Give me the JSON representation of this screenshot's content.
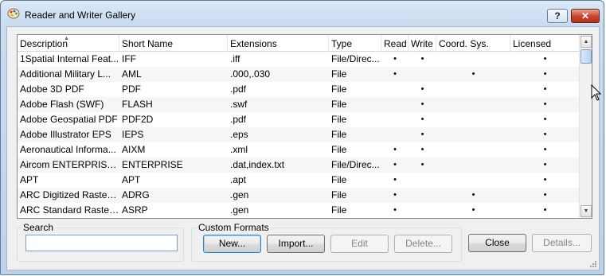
{
  "window": {
    "title": "Reader and Writer Gallery",
    "help_label": "?",
    "close_label": "✕"
  },
  "table": {
    "sorted_by": "Description",
    "headers": {
      "description": "Description",
      "short_name": "Short Name",
      "extensions": "Extensions",
      "type": "Type",
      "read": "Read",
      "write": "Write",
      "coord_sys": "Coord. Sys.",
      "licensed": "Licensed"
    },
    "rows": [
      {
        "description": "1Spatial Internal Feat...",
        "short_name": "IFF",
        "extensions": ".iff",
        "type": "File/Direc...",
        "read": "•",
        "write": "•",
        "coord_sys": "",
        "licensed": "•"
      },
      {
        "description": "Additional Military L...",
        "short_name": "AML",
        "extensions": ".000,.030",
        "type": "File",
        "read": "•",
        "write": "",
        "coord_sys": "•",
        "licensed": "•"
      },
      {
        "description": "Adobe 3D PDF",
        "short_name": "PDF",
        "extensions": ".pdf",
        "type": "File",
        "read": "",
        "write": "•",
        "coord_sys": "",
        "licensed": "•"
      },
      {
        "description": "Adobe Flash (SWF)",
        "short_name": "FLASH",
        "extensions": ".swf",
        "type": "File",
        "read": "",
        "write": "•",
        "coord_sys": "",
        "licensed": "•"
      },
      {
        "description": "Adobe Geospatial PDF",
        "short_name": "PDF2D",
        "extensions": ".pdf",
        "type": "File",
        "read": "",
        "write": "•",
        "coord_sys": "",
        "licensed": "•"
      },
      {
        "description": "Adobe Illustrator EPS",
        "short_name": "IEPS",
        "extensions": ".eps",
        "type": "File",
        "read": "",
        "write": "•",
        "coord_sys": "",
        "licensed": "•"
      },
      {
        "description": "Aeronautical Informa...",
        "short_name": "AIXM",
        "extensions": ".xml",
        "type": "File",
        "read": "•",
        "write": "•",
        "coord_sys": "",
        "licensed": "•"
      },
      {
        "description": "Aircom ENTERPRISE ...",
        "short_name": "ENTERPRISE",
        "extensions": ".dat,index.txt",
        "type": "File/Direc...",
        "read": "•",
        "write": "•",
        "coord_sys": "",
        "licensed": "•"
      },
      {
        "description": "APT",
        "short_name": "APT",
        "extensions": ".apt",
        "type": "File",
        "read": "•",
        "write": "",
        "coord_sys": "",
        "licensed": "•"
      },
      {
        "description": "ARC Digitized Raster ...",
        "short_name": "ADRG",
        "extensions": ".gen",
        "type": "File",
        "read": "•",
        "write": "",
        "coord_sys": "•",
        "licensed": "•"
      },
      {
        "description": "ARC Standard Raster ...",
        "short_name": "ASRP",
        "extensions": ".gen",
        "type": "File",
        "read": "•",
        "write": "",
        "coord_sys": "•",
        "licensed": "•"
      }
    ]
  },
  "search": {
    "label": "Search",
    "value": "",
    "placeholder": ""
  },
  "custom_formats": {
    "label": "Custom Formats",
    "new_label": "New...",
    "import_label": "Import...",
    "edit_label": "Edit",
    "delete_label": "Delete..."
  },
  "actions": {
    "close_label": "Close",
    "details_label": "Details..."
  },
  "icons": {
    "app": "palette-icon",
    "cursor": "mouse-pointer-icon"
  }
}
